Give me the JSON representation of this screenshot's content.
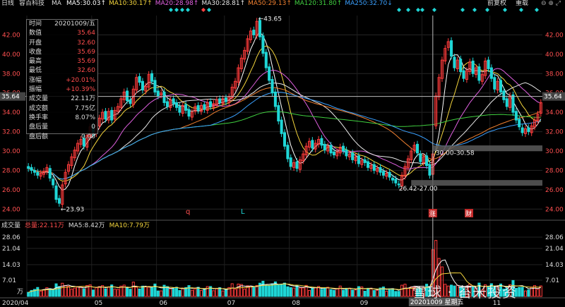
{
  "header": {
    "period": "日线",
    "stock_name": "容百科技",
    "ma_label": "MA",
    "ma": [
      {
        "label": "MA5:30.03",
        "color": "#ffffff"
      },
      {
        "label": "MA10:30.17",
        "color": "#f5d63d"
      },
      {
        "label": "MA20:28.98",
        "color": "#e060e0"
      },
      {
        "label": "MA30:28.81",
        "color": "#e8e8e8"
      },
      {
        "label": "MA50:29.13",
        "color": "#f08030"
      },
      {
        "label": "MA120:31.80",
        "color": "#40d040"
      },
      {
        "label": "MA250:32.70",
        "color": "#3aa0ff"
      }
    ],
    "arrows": [
      "↑",
      "↑",
      "↑",
      "↑",
      "↑",
      "↑",
      "↓"
    ],
    "adjust": "前复权",
    "overlay": "重载"
  },
  "info": [
    {
      "k": "时间",
      "v": "20201009/五",
      "c": "#dddddd"
    },
    {
      "k": "数值",
      "v": "35.64",
      "c": "#ff4d4d"
    },
    {
      "k": "开盘",
      "v": "32.60",
      "c": "#ff4d4d"
    },
    {
      "k": "收盘",
      "v": "35.69",
      "c": "#ff4d4d"
    },
    {
      "k": "最高",
      "v": "35.69",
      "c": "#ff4d4d"
    },
    {
      "k": "最低",
      "v": "32.60",
      "c": "#ff4d4d"
    },
    {
      "k": "涨幅",
      "v": "+20.01%",
      "c": "#ff4d4d"
    },
    {
      "k": "振幅",
      "v": "+10.39%",
      "c": "#ff4d4d"
    },
    {
      "k": "成交量",
      "v": "22.11万",
      "c": "#dddddd"
    },
    {
      "k": "成交额",
      "v": "7.75亿",
      "c": "#dddddd"
    },
    {
      "k": "换手率",
      "v": "8.07%",
      "c": "#dddddd"
    },
    {
      "k": "盘后量",
      "v": "0",
      "c": "#dddddd"
    },
    {
      "k": "盘后额",
      "v": "0.00",
      "c": "#dddddd"
    }
  ],
  "price_axis": [
    "42.00",
    "40.00",
    "38.00",
    "36.00",
    "34.00",
    "32.00",
    "30.00",
    "28.00",
    "26.00",
    "24.00"
  ],
  "current_price": "35.64",
  "annotations": {
    "high": "43.65",
    "low": "23.93",
    "range1": "30.00-30.58",
    "range2": "26.42-27.00",
    "mark_q": "q",
    "mark_l": "L",
    "mark_zhang": "涨",
    "mark_cai": "财"
  },
  "volume": {
    "title": "成交量",
    "total": "总量:22.11万",
    "ma5": "MA5:8.42万",
    "ma10": "MA10:7.79万",
    "unit": "万",
    "axis": [
      "28.06",
      "21.04",
      "14.03",
      "7.01"
    ]
  },
  "date_axis": [
    "2020/04",
    "05",
    "06",
    "07",
    "08",
    "09",
    "10",
    "11"
  ],
  "crosshair_date": "20201009 星期五",
  "watermark": "雪球 · 苔米投资",
  "colors": {
    "up": "#ff3b3b",
    "down": "#1fd6d6",
    "ma5": "#ffffff",
    "ma10": "#f5d63d",
    "ma20": "#e060e0",
    "ma30": "#e8e8e8",
    "ma50": "#f08030",
    "ma120": "#40d040",
    "ma250": "#3aa0ff"
  },
  "chart_data": {
    "type": "candlestick",
    "ylim": [
      23,
      44
    ],
    "close": [
      28.2,
      28.0,
      27.8,
      27.5,
      27.7,
      27.9,
      28.3,
      27.2,
      26.5,
      25.0,
      24.6,
      26.5,
      27.8,
      28.6,
      29.4,
      30.1,
      30.8,
      31.2,
      30.5,
      31.6,
      32.5,
      31.9,
      32.7,
      33.4,
      34.0,
      33.3,
      34.1,
      33.2,
      34.2,
      34.6,
      35.4,
      36.1,
      35.2,
      34.9,
      36.4,
      37.6,
      37.1,
      36.3,
      36.7,
      37.9,
      37.2,
      36.1,
      35.7,
      36.0,
      35.0,
      34.6,
      35.3,
      34.9,
      34.5,
      34.0,
      34.7,
      34.2,
      33.6,
      34.0,
      34.6,
      34.2,
      34.7,
      34.3,
      35.0,
      34.6,
      34.9,
      35.3,
      35.0,
      35.4,
      35.1,
      35.6,
      36.6,
      37.2,
      38.6,
      39.6,
      40.4,
      41.6,
      42.4,
      42.0,
      43.4,
      41.8,
      40.1,
      38.6,
      37.3,
      36.0,
      34.6,
      33.1,
      31.8,
      30.5,
      29.2,
      28.4,
      28.8,
      28.2,
      29.1,
      29.7,
      30.5,
      31.0,
      30.3,
      30.8,
      31.2,
      30.6,
      30.1,
      30.5,
      29.8,
      29.6,
      29.9,
      30.4,
      30.0,
      29.5,
      29.7,
      29.1,
      29.4,
      28.7,
      29.0,
      28.8,
      28.3,
      28.5,
      28.0,
      28.2,
      27.8,
      27.5,
      27.7,
      27.3,
      27.0,
      26.7,
      26.5,
      27.5,
      28.4,
      29.2,
      30.0,
      30.6,
      29.8,
      28.9,
      29.4,
      28.5,
      27.5,
      29.7,
      35.69,
      37.6,
      39.4,
      40.6,
      41.3,
      39.8,
      38.6,
      39.4,
      38.2,
      37.5,
      38.3,
      39.2,
      38.0,
      38.6,
      37.3,
      37.9,
      39.3,
      38.5,
      37.5,
      36.4,
      37.2,
      36.1,
      35.3,
      34.6,
      35.7,
      34.0,
      33.2,
      32.5,
      31.9,
      32.3,
      32.0,
      32.6,
      33.2,
      33.8,
      35.0
    ],
    "open": [
      28.4,
      28.3,
      28.0,
      27.8,
      27.4,
      27.6,
      27.9,
      28.2,
      27.1,
      26.4,
      25.1,
      24.5,
      26.6,
      27.9,
      28.5,
      29.3,
      30.0,
      30.7,
      31.3,
      30.4,
      31.5,
      32.6,
      31.8,
      32.6,
      33.3,
      34.1,
      33.2,
      34.2,
      33.3,
      34.1,
      34.5,
      35.3,
      36.2,
      35.3,
      34.8,
      36.3,
      37.7,
      37.2,
      36.2,
      36.6,
      38.0,
      37.3,
      36.2,
      35.8,
      36.1,
      35.1,
      34.5,
      35.4,
      35.0,
      34.6,
      33.9,
      34.8,
      34.3,
      33.5,
      34.1,
      34.7,
      34.1,
      34.8,
      34.2,
      35.1,
      34.5,
      34.8,
      35.4,
      34.9,
      35.5,
      35.0,
      35.5,
      36.5,
      37.1,
      38.5,
      39.5,
      40.3,
      41.5,
      42.5,
      41.9,
      43.5,
      41.9,
      40.2,
      38.7,
      37.4,
      36.1,
      34.7,
      33.2,
      31.9,
      30.6,
      29.3,
      28.3,
      28.9,
      28.1,
      29.0,
      29.6,
      30.4,
      31.1,
      30.2,
      30.7,
      31.3,
      30.7,
      30.0,
      30.6,
      29.9,
      29.5,
      29.8,
      30.5,
      30.1,
      29.4,
      29.8,
      29.0,
      29.5,
      28.6,
      29.1,
      28.9,
      28.2,
      28.6,
      27.9,
      28.3,
      27.9,
      27.4,
      27.8,
      27.2,
      27.1,
      26.6,
      26.4,
      27.4,
      28.3,
      29.1,
      30.1,
      30.7,
      29.7,
      28.8,
      29.5,
      28.6,
      27.6,
      32.6,
      35.6,
      37.5,
      39.3,
      40.7,
      41.4,
      39.7,
      38.5,
      39.5,
      38.3,
      37.4,
      38.2,
      39.3,
      37.9,
      38.7,
      37.2,
      37.8,
      39.4,
      38.6,
      37.6,
      36.3,
      37.3,
      36.2,
      35.4,
      34.5,
      35.8,
      34.1,
      33.3,
      32.4,
      31.8,
      32.4,
      31.9,
      32.5,
      33.1,
      33.9
    ]
  }
}
